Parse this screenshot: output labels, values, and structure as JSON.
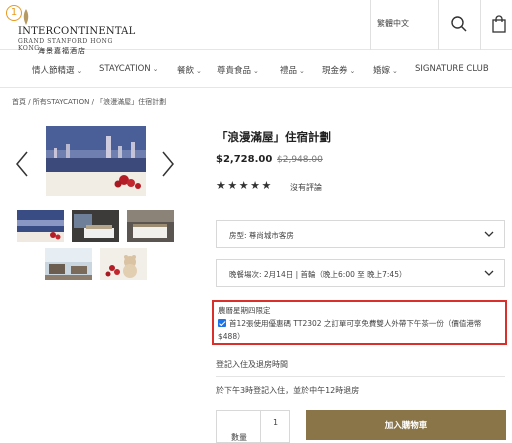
{
  "header": {
    "badge_number": "1",
    "logo_main": "INTERCONTINENTAL",
    "logo_sub": "GRAND STANFORD HONG KONG",
    "logo_cn": "海景嘉福酒店",
    "language": "繁體中文",
    "icons": [
      "search-icon",
      "shopping-bag-icon"
    ]
  },
  "nav": {
    "items": [
      {
        "label": "情人節精選",
        "has_dropdown": true
      },
      {
        "label": "STAYCATION",
        "has_dropdown": true
      },
      {
        "label": "餐飲",
        "has_dropdown": true
      },
      {
        "label": "尊貴食品",
        "has_dropdown": true
      },
      {
        "label": "禮品",
        "has_dropdown": true
      },
      {
        "label": "現金券",
        "has_dropdown": true
      },
      {
        "label": "婚嫁",
        "has_dropdown": true
      },
      {
        "label": "SIGNATURE CLUB",
        "has_dropdown": false
      }
    ]
  },
  "breadcrumb": "首頁 / 所有STAYCATION / 「浪漫滿屋」住宿計劃",
  "gallery": {
    "main_image": "romantic-harbour-view-image",
    "thumbnails": [
      "harbour-view-thumbnail",
      "guest-room-thumbnail",
      "suite-room-thumbnail",
      "lounge-thumbnail",
      "teddy-bear-roses-thumbnail"
    ],
    "icons": [
      "chevron-left-icon",
      "chevron-right-icon"
    ]
  },
  "product": {
    "title": "「浪漫滿屋」住宿計劃",
    "price": "$2,728.00",
    "original_price": "$2,948.00",
    "stars": "★★★★★",
    "rating_value": 0,
    "review_text": "沒有評論"
  },
  "options": {
    "room_type": "房型:  尊尚城市客房",
    "dinner_slot": "晚餐場次:  2月14日 | 首輪（晚上6:00 至 晚上7:45）"
  },
  "promo": {
    "title": "農曆星期四限定",
    "checked": true,
    "text": "首12張使用優惠碼 TT2302 之訂單可享免費雙人外帶下午茶一份（價值港幣",
    "text2": "$488）"
  },
  "checkin": {
    "label": "登記入住及退房時間",
    "detail": "於下午3時登記入住，並於中午12時退房"
  },
  "quantity": {
    "label": "數量",
    "value": "1"
  },
  "cart_button": "加入購物車",
  "colors": {
    "accent_gold": "#8a7549",
    "promo_border": "#d9302c",
    "badge": "#e89a1e",
    "checkbox": "#1a73e8"
  }
}
